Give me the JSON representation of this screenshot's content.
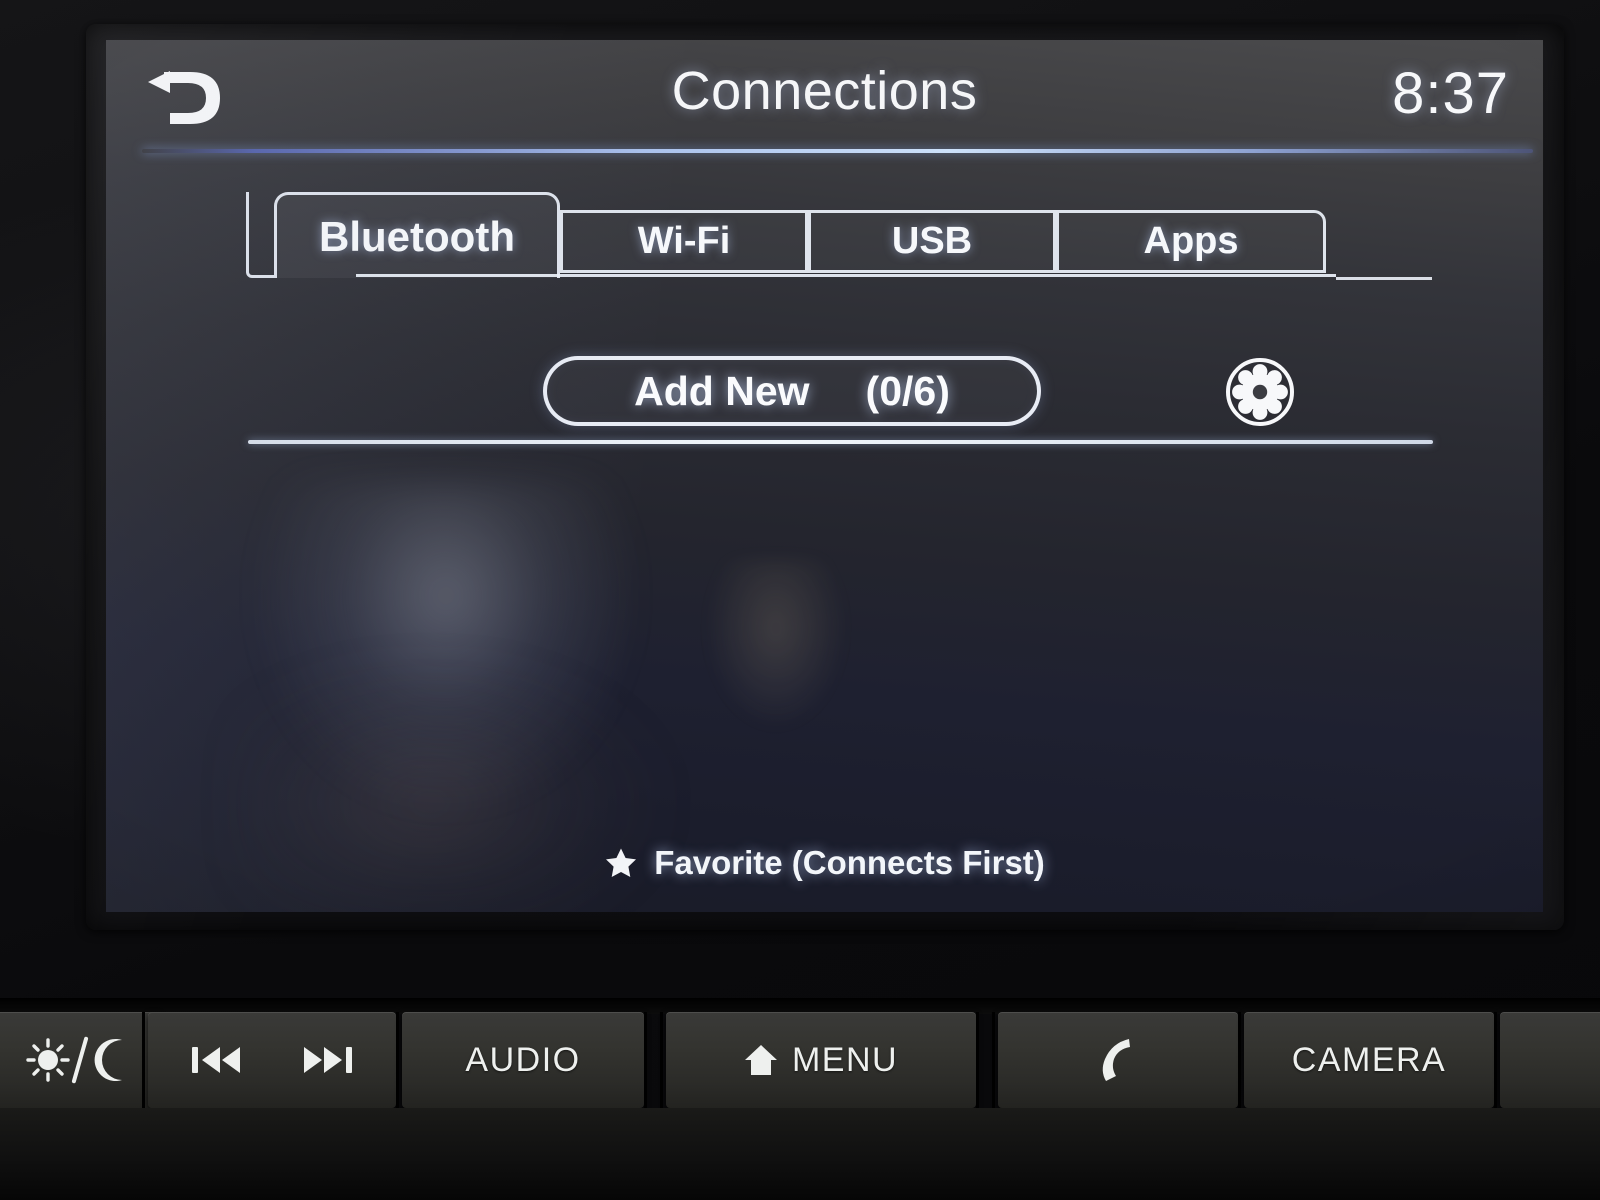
{
  "screen": {
    "header": {
      "back_icon": "back-arrow-icon",
      "title": "Connections",
      "clock": "8:37"
    },
    "tabs": [
      {
        "label": "Bluetooth",
        "selected": true
      },
      {
        "label": "Wi-Fi",
        "selected": false
      },
      {
        "label": "USB",
        "selected": false
      },
      {
        "label": "Apps",
        "selected": false
      }
    ],
    "toolbar": {
      "add_new_label": "Add New",
      "add_new_count": "(0/6)",
      "settings_icon": "gear-icon"
    },
    "device_list": {
      "items": []
    },
    "footer": {
      "star_icon": "star-icon",
      "legend": "Favorite (Connects First)"
    }
  },
  "hardware_buttons": [
    {
      "label": "",
      "icon": "day-night-brightness-icon"
    },
    {
      "label": "",
      "icon": "prev-next-track-icon"
    },
    {
      "label": "AUDIO",
      "icon": ""
    },
    {
      "label": "MENU",
      "icon": "home-icon"
    },
    {
      "label": "",
      "icon": "phone-icon"
    },
    {
      "label": "CAMERA",
      "icon": ""
    },
    {
      "label": "",
      "icon": ""
    }
  ],
  "colors": {
    "screen_text": "#f5f6f8",
    "accent_rule": "#b0c8f5",
    "bezel": "#131315",
    "button_face": "#33332f"
  }
}
